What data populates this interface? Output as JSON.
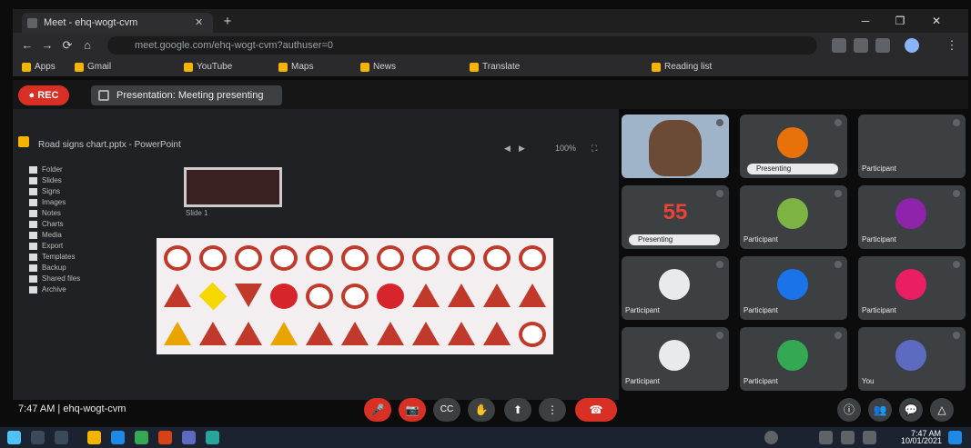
{
  "browser": {
    "tab_title": "Meet - ehq-wogt-cvm",
    "tab_close": "✕",
    "new_tab": "+",
    "window_controls": [
      "─",
      "❐",
      "✕"
    ],
    "nav": [
      "←",
      "→",
      "⟳",
      "⌂"
    ],
    "address": "meet.google.com/ehq-wogt-cvm?authuser=0",
    "bookmarks": [
      "Apps",
      "Gmail",
      "YouTube",
      "Maps",
      "News",
      "Translate",
      "Reading list"
    ]
  },
  "extension": {
    "rec_label": "● REC",
    "share_status": "Presentation: Meeting presenting"
  },
  "presentation": {
    "window_title": "Road signs chart.pptx - PowerPoint",
    "controls": [
      "◀",
      "▶",
      "100%",
      "⛶"
    ],
    "tree_items": [
      "Folder",
      "Slides",
      "Signs",
      "Images",
      "Notes",
      "Charts",
      "Media",
      "Export",
      "Templates",
      "Backup",
      "Shared files",
      "Archive"
    ],
    "thumb_label": "Slide 1",
    "sign_rows": [
      [
        "circle",
        "circle",
        "circle",
        "circle",
        "circle",
        "circle",
        "circle",
        "circle",
        "circle",
        "circle",
        "circle"
      ],
      [
        "tri",
        "diamond",
        "tri-inv",
        "stop",
        "circle",
        "circle",
        "stop",
        "tri",
        "tri",
        "tri",
        "tri"
      ],
      [
        "tri-y",
        "tri",
        "tri",
        "tri-y",
        "tri",
        "tri",
        "tri",
        "tri",
        "tri",
        "tri",
        "circle"
      ]
    ]
  },
  "participants": [
    {
      "name": "",
      "type": "video"
    },
    {
      "name": "Presenting",
      "avatar": "",
      "color": "#e8710a",
      "type": "pill"
    },
    {
      "name": "Participant",
      "avatar": "",
      "color": "#3c4043",
      "type": "avatar-small"
    },
    {
      "name": "Presenting",
      "avatar": "55",
      "color": "#ea4335",
      "type": "number"
    },
    {
      "name": "Participant",
      "avatar": "",
      "color": "#7cb342",
      "type": "avatar"
    },
    {
      "name": "Participant",
      "avatar": "",
      "color": "#8e24aa",
      "type": "avatar"
    },
    {
      "name": "Participant",
      "avatar": "",
      "color": "#e8eaed",
      "type": "avatar"
    },
    {
      "name": "Participant",
      "avatar": "",
      "color": "#1a73e8",
      "type": "avatar"
    },
    {
      "name": "Participant",
      "avatar": "",
      "color": "#e91e63",
      "type": "avatar"
    },
    {
      "name": "Participant",
      "avatar": "",
      "color": "#e8eaed",
      "type": "avatar"
    },
    {
      "name": "Participant",
      "avatar": "",
      "color": "#34a853",
      "type": "avatar"
    },
    {
      "name": "You",
      "avatar": "",
      "color": "#5c6bc0",
      "type": "avatar"
    }
  ],
  "controls": {
    "meeting_code": "7:47 AM | ehq-wogt-cvm",
    "mic": "🎤",
    "camera": "📷",
    "captions": "CC",
    "raise_hand": "✋",
    "present": "⬆",
    "more": "⋮",
    "end_call": "☎",
    "right": [
      "ⓘ",
      "👥",
      "💬",
      "△"
    ]
  },
  "taskbar": {
    "time": "7:47 AM",
    "date": "10/01/2021"
  }
}
